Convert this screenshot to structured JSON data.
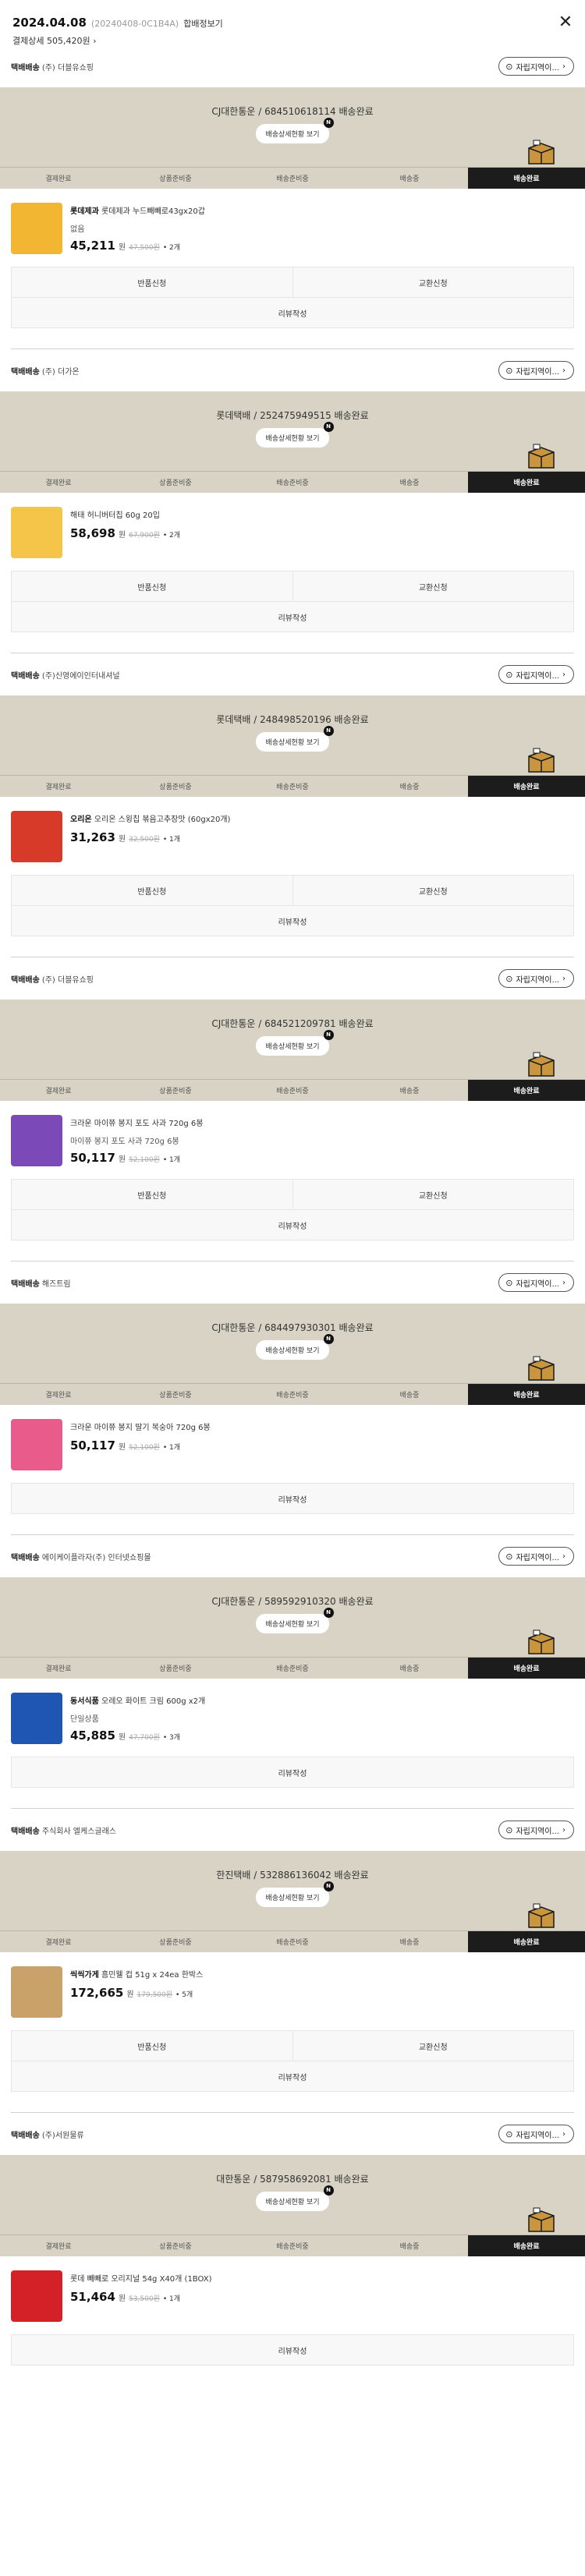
{
  "header": {
    "date": "2024.04.08",
    "order_no": "(20240408-0C1B4A)",
    "merge_label": "합배정보기",
    "payment": "결제상세 505,420원",
    "payment_chevron": "›",
    "close_glyph": "✕"
  },
  "common": {
    "ship_type": "택배배송",
    "pickup_label": "자립지역이...",
    "detail_btn": "배송상세현황 보기",
    "badge": "N",
    "steps": [
      "결제완료",
      "상품준비중",
      "배송준비중",
      "배송중",
      "배송완료"
    ],
    "active_step": 4,
    "return_label": "반품신청",
    "exchange_label": "교환신청",
    "review_label": "리뷰작성"
  },
  "orders": [
    {
      "seller": "(주) 더블유쇼핑",
      "courier": "CJ대한통운 / 684510618114 배송완료",
      "brand": "롯데제과",
      "product": "롯데제과 누드빼빼로43gx20갑",
      "option": "없음",
      "price": "45,211",
      "won": "원",
      "original": "47,500원",
      "qty": "• 2개",
      "thumb_color": "#f2b632",
      "show_return": true
    },
    {
      "seller": "(주) 더가온",
      "courier": "롯데택배 / 252475949515 배송완료",
      "brand": "",
      "product": "해태 허니버터칩 60g 20입",
      "option": "",
      "price": "58,698",
      "won": "원",
      "original": "67,900원",
      "qty": "• 2개",
      "thumb_color": "#f4c548",
      "show_return": true
    },
    {
      "seller": "(주)신영에이인터내셔널",
      "courier": "롯데택배 / 248498520196 배송완료",
      "brand": "오리온",
      "product": "오리온 스윙칩 볶음고추장맛 (60gx20개)",
      "option": "",
      "price": "31,263",
      "won": "원",
      "original": "32,500원",
      "qty": "• 1개",
      "thumb_color": "#d83a2a",
      "show_return": true
    },
    {
      "seller": "(주) 더블유쇼핑",
      "courier": "CJ대한통운 / 684521209781 배송완료",
      "brand": "",
      "product": "크라운 마이쮸 봉지 포도 사과 720g 6봉",
      "option": "마이쮸 봉지 포도 사과 720g 6봉",
      "price": "50,117",
      "won": "원",
      "original": "52,100원",
      "qty": "• 1개",
      "thumb_color": "#7b4ab8",
      "show_return": true
    },
    {
      "seller": "해즈트림",
      "courier": "CJ대한통운 / 684497930301 배송완료",
      "brand": "",
      "product": "크라운 마이쮸 봉지 딸기 복숭아 720g 6봉",
      "option": "",
      "price": "50,117",
      "won": "원",
      "original": "52,100원",
      "qty": "• 1개",
      "thumb_color": "#e85b8a",
      "show_return": false
    },
    {
      "seller": "에이케이플라자(주) 인터넷쇼핑몰",
      "courier": "CJ대한통운 / 589592910320 배송완료",
      "brand": "동서식품",
      "product": "오레오 화이트 크림 600g x2개",
      "option": "단일상품",
      "price": "45,885",
      "won": "원",
      "original": "47,700원",
      "qty": "• 3개",
      "thumb_color": "#1f56b3",
      "show_return": false
    },
    {
      "seller": "주식회사 엘케스글래스",
      "courier": "한진택배 / 532886136042 배송완료",
      "brand": "씩씩가게",
      "product": "흠민웰 컵 51g x 24ea 한박스",
      "option": "",
      "price": "172,665",
      "won": "원",
      "original": "179,500원",
      "qty": "• 5개",
      "thumb_color": "#c9a26a",
      "show_return": true
    },
    {
      "seller": "(주)서원물류",
      "courier": "대한통운 / 587958692081 배송완료",
      "brand": "",
      "product": "롯데 빼빼로 오리지널 54g X40개 (1BOX)",
      "option": "",
      "price": "51,464",
      "won": "원",
      "original": "53,500원",
      "qty": "• 1개",
      "thumb_color": "#d42027",
      "show_return": false
    }
  ]
}
